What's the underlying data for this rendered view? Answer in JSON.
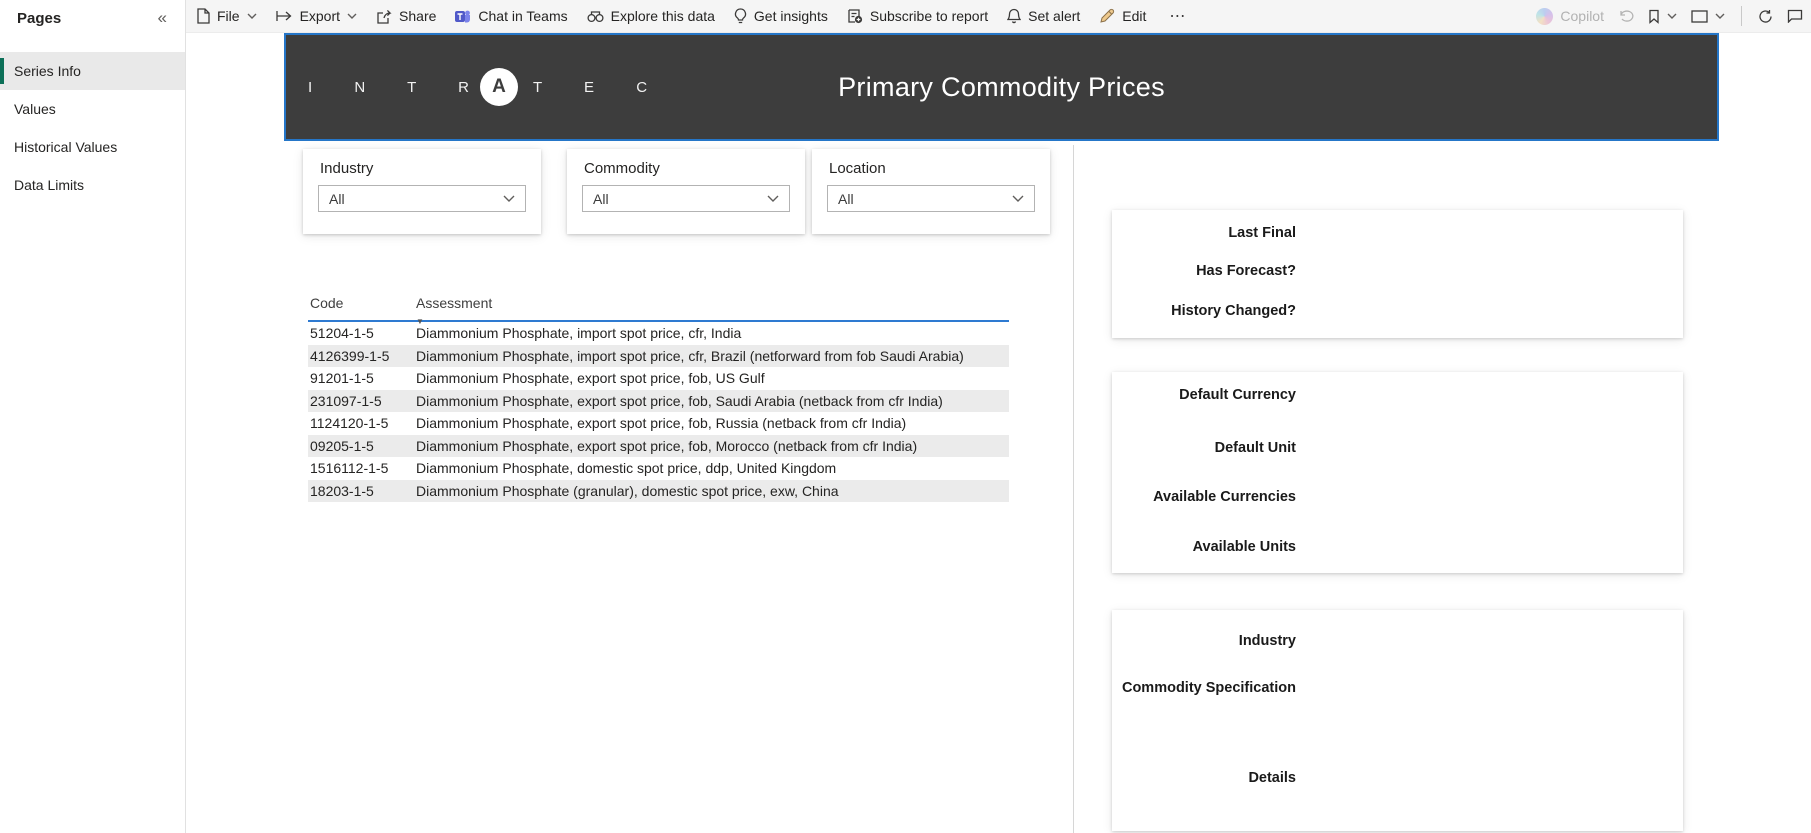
{
  "sidebar": {
    "title": "Pages",
    "collapse_icon": "«",
    "items": [
      {
        "label": "Series Info",
        "selected": true
      },
      {
        "label": "Values",
        "selected": false
      },
      {
        "label": "Historical Values",
        "selected": false
      },
      {
        "label": "Data Limits",
        "selected": false
      }
    ]
  },
  "toolbar": {
    "file": "File",
    "export": "Export",
    "share": "Share",
    "teams": "Chat in Teams",
    "explore": "Explore this data",
    "insights": "Get insights",
    "subscribe": "Subscribe to report",
    "alert": "Set alert",
    "edit": "Edit",
    "more": "⋯",
    "copilot": "Copilot"
  },
  "banner": {
    "brand": "INTRATEC",
    "logo_prefix": "I N T R",
    "logo_circle_letter": "A",
    "logo_suffix": "T E C",
    "title": "Primary Commodity Prices"
  },
  "filters": [
    {
      "label": "Industry",
      "value": "All"
    },
    {
      "label": "Commodity",
      "value": "All"
    },
    {
      "label": "Location",
      "value": "All"
    }
  ],
  "table": {
    "columns": [
      "Code",
      "Assessment"
    ],
    "sorted_by": "Assessment",
    "sort_indicator": "▼",
    "rows": [
      {
        "code": "51204-1-5",
        "assessment": "Diammonium Phosphate, import spot price, cfr, India"
      },
      {
        "code": "4126399-1-5",
        "assessment": "Diammonium Phosphate, import spot price, cfr, Brazil (netforward from fob Saudi Arabia)"
      },
      {
        "code": "91201-1-5",
        "assessment": "Diammonium Phosphate, export spot price, fob, US Gulf"
      },
      {
        "code": "231097-1-5",
        "assessment": "Diammonium Phosphate, export spot price, fob, Saudi Arabia (netback from cfr India)"
      },
      {
        "code": "1124120-1-5",
        "assessment": "Diammonium Phosphate, export spot price, fob, Russia (netback from cfr India)"
      },
      {
        "code": "09205-1-5",
        "assessment": "Diammonium Phosphate, export spot price, fob, Morocco (netback from cfr India)"
      },
      {
        "code": "1516112-1-5",
        "assessment": "Diammonium Phosphate, domestic spot price, ddp, United Kingdom"
      },
      {
        "code": "18203-1-5",
        "assessment": "Diammonium Phosphate (granular), domestic spot price, exw, China"
      }
    ]
  },
  "panel": {
    "cards": [
      {
        "labels": [
          "Last Final",
          "Has Forecast?",
          "History Changed?"
        ]
      },
      {
        "labels": [
          "Default Currency",
          "Default Unit",
          "Available Currencies",
          "Available Units"
        ]
      },
      {
        "labels": [
          "Industry",
          "Commodity Specification",
          "Details"
        ]
      }
    ]
  },
  "colors": {
    "banner_bg": "#3d3d3d",
    "selection_border_blue": "#2576c8",
    "table_header_line_blue": "#2e7ad1",
    "sidebar_selected_green": "#0c7058",
    "teams_purple": "#5059c9"
  }
}
